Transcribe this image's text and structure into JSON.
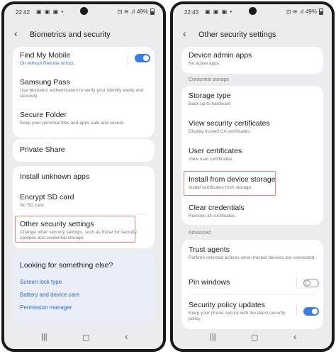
{
  "left": {
    "status": {
      "time": "22:42",
      "notifications": "▣ ▣ ▣ •",
      "signal": "⊡ ≋ .ıl",
      "battery": "49%"
    },
    "header": {
      "title": "Biometrics and security"
    },
    "items": {
      "find_my_mobile": {
        "title": "Find My Mobile",
        "subtitle": "On without Remote unlock"
      },
      "samsung_pass": {
        "title": "Samsung Pass",
        "subtitle": "Use biometric authentication to verify your identity easily and securely."
      },
      "secure_folder": {
        "title": "Secure Folder",
        "subtitle": "Keep your personal files and apps safe and secure."
      },
      "private_share": {
        "title": "Private Share"
      },
      "install_unknown": {
        "title": "Install unknown apps"
      },
      "encrypt_sd": {
        "title": "Encrypt SD card",
        "subtitle": "No SD card"
      },
      "other_security": {
        "title": "Other security settings",
        "subtitle": "Change other security settings, such as those for security updates and credential storage."
      }
    },
    "suggest": {
      "question": "Looking for something else?",
      "links": [
        "Screen lock type",
        "Battery and device care",
        "Permission manager"
      ]
    },
    "nav": {
      "recents": "|||",
      "home": "▢",
      "back": "‹"
    }
  },
  "right": {
    "status": {
      "time": "22:43",
      "notifications": "▣ ▣ ▣ •",
      "signal": "⊡ ≋ .ıl",
      "battery": "49%"
    },
    "header": {
      "title": "Other security settings"
    },
    "items": {
      "device_admin": {
        "title": "Device admin apps",
        "subtitle": "No active apps"
      },
      "credential_section": "Credential storage",
      "storage_type": {
        "title": "Storage type",
        "subtitle": "Back up to hardware"
      },
      "view_certs": {
        "title": "View security certificates",
        "subtitle": "Display trusted CA certificates."
      },
      "user_certs": {
        "title": "User certificates",
        "subtitle": "View user certificates."
      },
      "install_storage": {
        "title": "Install from device storage",
        "subtitle": "Install certificates from storage."
      },
      "clear_creds": {
        "title": "Clear credentials",
        "subtitle": "Remove all certificates."
      },
      "advanced_section": "Advanced",
      "trust_agents": {
        "title": "Trust agents",
        "subtitle": "Perform selected actions when trusted devices are connected."
      },
      "pin_windows": {
        "title": "Pin windows"
      },
      "policy_updates": {
        "title": "Security policy updates",
        "subtitle": "Keep your phone secure with the latest security policy."
      }
    },
    "nav": {
      "recents": "|||",
      "home": "▢",
      "back": "‹"
    }
  },
  "colors": {
    "accent": "#3b7de0",
    "link": "#2f66c9",
    "highlight": "#e8857a",
    "background": "#ececef"
  }
}
